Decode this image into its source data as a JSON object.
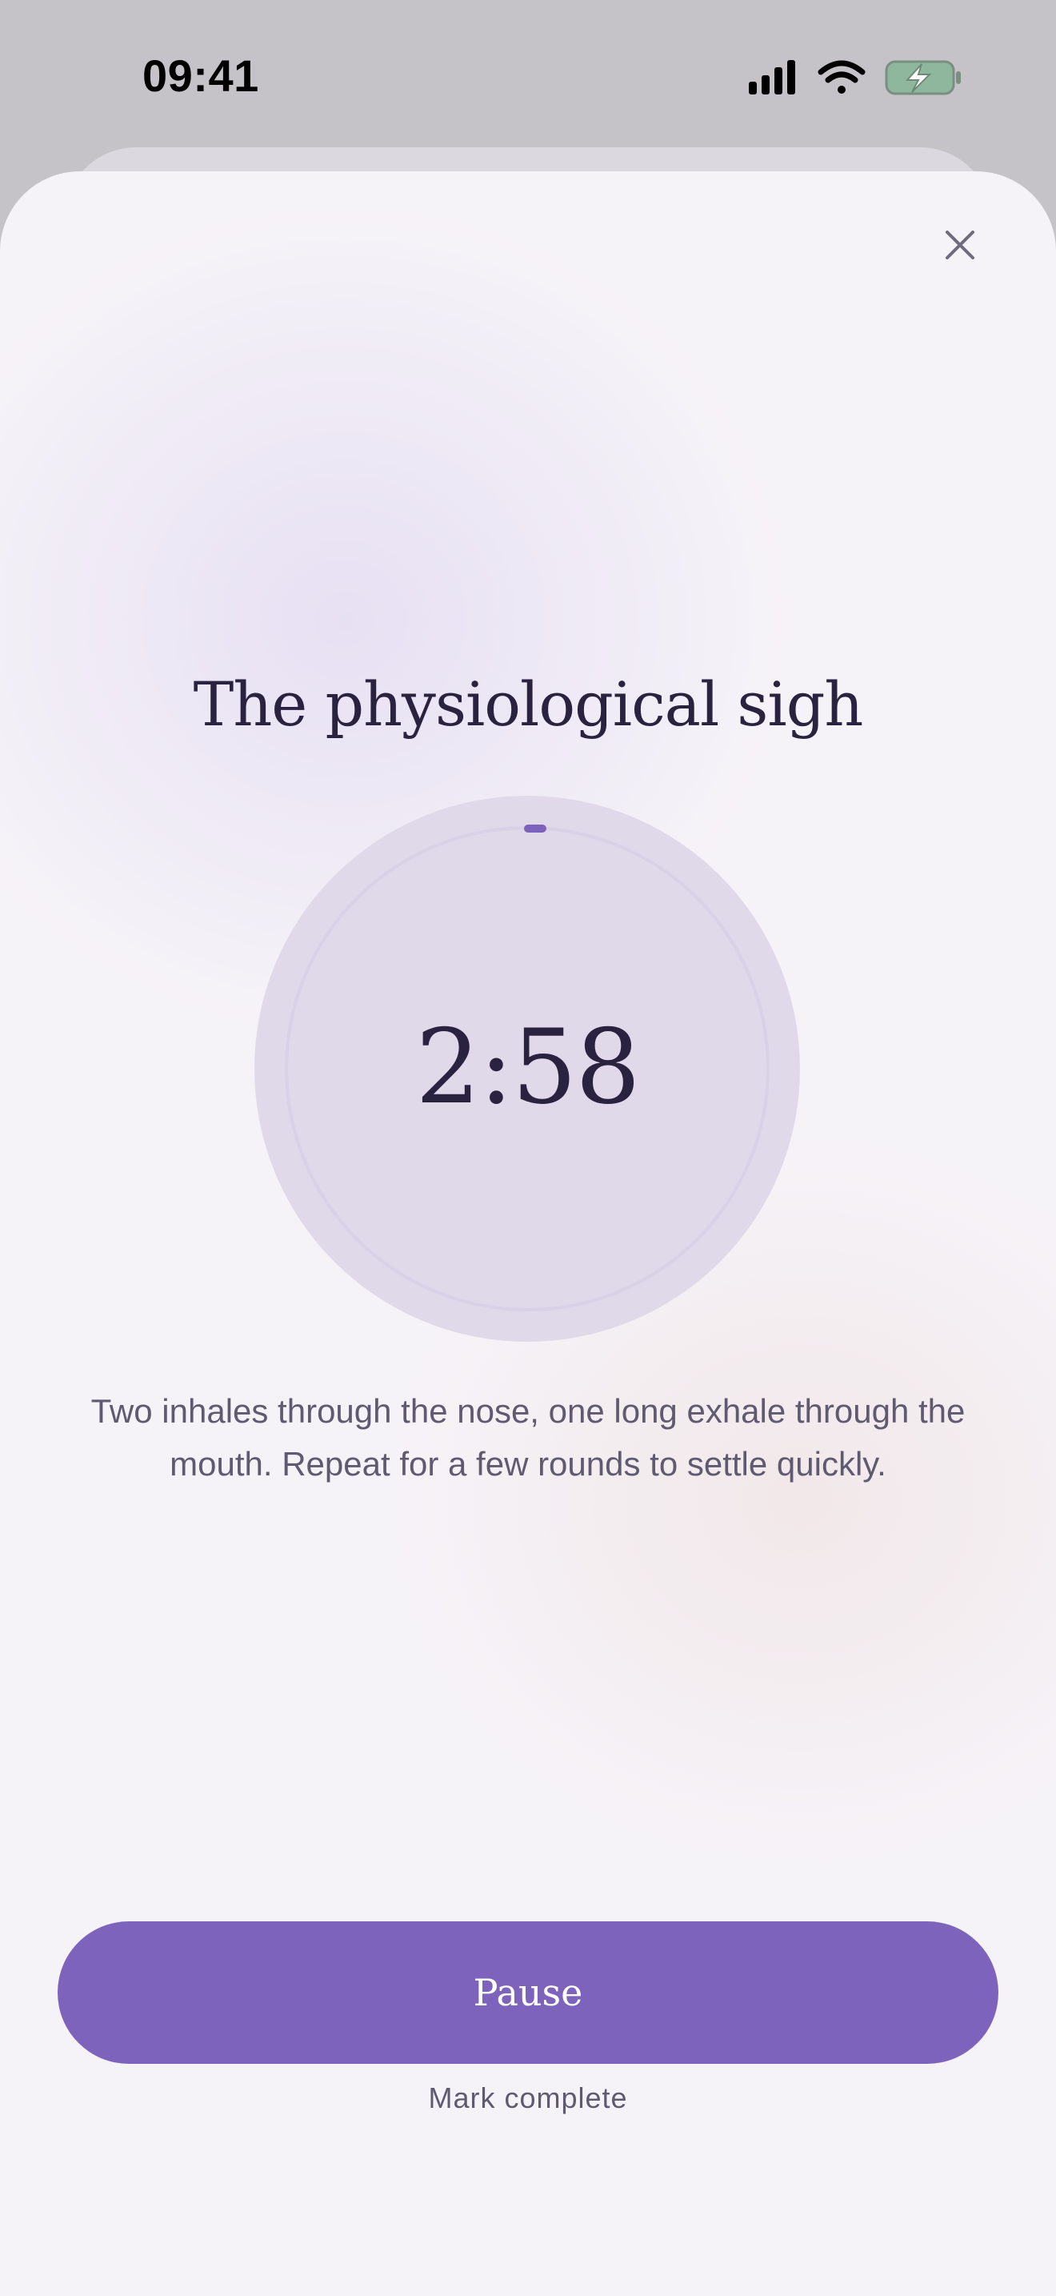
{
  "status_bar": {
    "time": "09:41",
    "icons": [
      "cellular-signal-icon",
      "wifi-icon",
      "battery-charging-icon"
    ],
    "battery_color": "#8fb79e"
  },
  "exercise": {
    "title": "The physiological sigh",
    "timer": "2:58",
    "description": "Two inhales through the nose, one long exhale through the mouth. Repeat for a few rounds to settle quickly."
  },
  "actions": {
    "primary_label": "Pause",
    "secondary_label": "Mark complete",
    "close_icon": "close-icon"
  },
  "colors": {
    "accent": "#7e63bd",
    "text_primary": "#2a2340",
    "text_secondary": "#5f5a70",
    "timer_circle": "#e0d9ea"
  }
}
